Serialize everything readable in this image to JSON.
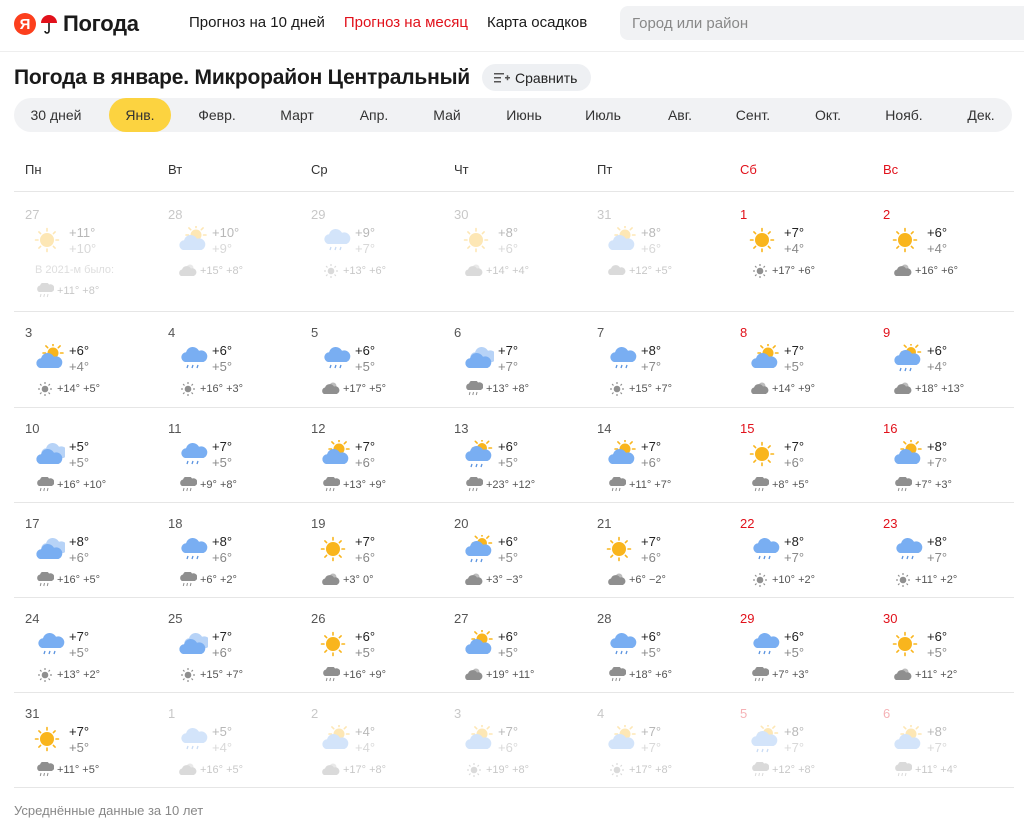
{
  "header": {
    "logo_ya": "Я",
    "logo_text": "Погода",
    "nav": [
      {
        "label": "Прогноз на 10 дней",
        "active": false
      },
      {
        "label": "Прогноз на месяц",
        "active": true
      },
      {
        "label": "Карта осадков",
        "active": false
      }
    ],
    "search_placeholder": "Город или район"
  },
  "title": "Погода в январе. Микрорайон Центральный",
  "compare_label": "Сравнить",
  "months": [
    "30 дней",
    "Янв.",
    "Февр.",
    "Март",
    "Апр.",
    "Май",
    "Июнь",
    "Июль",
    "Авг.",
    "Сент.",
    "Окт.",
    "Нояб.",
    "Дек."
  ],
  "active_month": "Янв.",
  "weekdays": [
    "Пн",
    "Вт",
    "Ср",
    "Чт",
    "Пт",
    "Сб",
    "Вс"
  ],
  "colors": {
    "accent": "#fcd340",
    "weekend": "#e1111b",
    "sun": "#f9b51d",
    "cloud": "#79aef2"
  },
  "weeks": [
    [
      {
        "day": "27",
        "faded": true,
        "icon": "sun",
        "hi": "+11°",
        "lo": "+10°",
        "note": "В 2021-м было:",
        "clim_icon": "rain",
        "clim": "+11° +8°"
      },
      {
        "day": "28",
        "faded": true,
        "icon": "sun-cloud",
        "hi": "+10°",
        "lo": "+9°",
        "clim_icon": "cloudy-sun",
        "clim": "+15° +8°"
      },
      {
        "day": "29",
        "faded": true,
        "icon": "cloud-rain",
        "hi": "+9°",
        "lo": "+7°",
        "clim_icon": "sun",
        "clim": "+13° +6°"
      },
      {
        "day": "30",
        "faded": true,
        "icon": "sun",
        "hi": "+8°",
        "lo": "+6°",
        "clim_icon": "cloudy-sun",
        "clim": "+14° +4°"
      },
      {
        "day": "31",
        "faded": true,
        "icon": "sun-cloud",
        "hi": "+8°",
        "lo": "+6°",
        "clim_icon": "cloud",
        "clim": "+12° +5°"
      },
      {
        "day": "1",
        "faded": false,
        "icon": "sun",
        "hi": "+7°",
        "lo": "+4°",
        "clim_icon": "sun",
        "clim": "+17° +6°"
      },
      {
        "day": "2",
        "faded": false,
        "icon": "sun",
        "hi": "+6°",
        "lo": "+4°",
        "clim_icon": "cloudy-sun",
        "clim": "+16° +6°"
      }
    ],
    [
      {
        "day": "3",
        "faded": false,
        "icon": "sun-cloud",
        "hi": "+6°",
        "lo": "+4°",
        "clim_icon": "sun",
        "clim": "+14° +5°"
      },
      {
        "day": "4",
        "faded": false,
        "icon": "cloud-rain",
        "hi": "+6°",
        "lo": "+5°",
        "clim_icon": "sun",
        "clim": "+16° +3°"
      },
      {
        "day": "5",
        "faded": false,
        "icon": "cloud-rain",
        "hi": "+6°",
        "lo": "+5°",
        "clim_icon": "cloudy-sun",
        "clim": "+17° +5°"
      },
      {
        "day": "6",
        "faded": false,
        "icon": "cloud",
        "hi": "+7°",
        "lo": "+7°",
        "clim_icon": "rain",
        "clim": "+13° +8°"
      },
      {
        "day": "7",
        "faded": false,
        "icon": "cloud-rain",
        "hi": "+8°",
        "lo": "+7°",
        "clim_icon": "sun",
        "clim": "+15° +7°"
      },
      {
        "day": "8",
        "faded": false,
        "icon": "sun-cloud",
        "hi": "+7°",
        "lo": "+5°",
        "clim_icon": "cloudy-sun",
        "clim": "+14° +9°"
      },
      {
        "day": "9",
        "faded": false,
        "icon": "sun-cloud-rain",
        "hi": "+6°",
        "lo": "+4°",
        "clim_icon": "cloudy-sun",
        "clim": "+18° +13°"
      }
    ],
    [
      {
        "day": "10",
        "faded": false,
        "icon": "cloud",
        "hi": "+5°",
        "lo": "+5°",
        "clim_icon": "rain",
        "clim": "+16° +10°"
      },
      {
        "day": "11",
        "faded": false,
        "icon": "cloud-rain",
        "hi": "+7°",
        "lo": "+5°",
        "clim_icon": "rain",
        "clim": "+9° +8°"
      },
      {
        "day": "12",
        "faded": false,
        "icon": "sun-cloud",
        "hi": "+7°",
        "lo": "+6°",
        "clim_icon": "rain",
        "clim": "+13° +9°"
      },
      {
        "day": "13",
        "faded": false,
        "icon": "sun-cloud-rain",
        "hi": "+6°",
        "lo": "+5°",
        "clim_icon": "rain",
        "clim": "+23° +12°"
      },
      {
        "day": "14",
        "faded": false,
        "icon": "sun-cloud",
        "hi": "+7°",
        "lo": "+6°",
        "clim_icon": "rain",
        "clim": "+11° +7°"
      },
      {
        "day": "15",
        "faded": false,
        "icon": "sun",
        "hi": "+7°",
        "lo": "+6°",
        "clim_icon": "rain",
        "clim": "+8° +5°"
      },
      {
        "day": "16",
        "faded": false,
        "icon": "sun-cloud",
        "hi": "+8°",
        "lo": "+7°",
        "clim_icon": "rain",
        "clim": "+7° +3°"
      }
    ],
    [
      {
        "day": "17",
        "faded": false,
        "icon": "cloud",
        "hi": "+8°",
        "lo": "+6°",
        "clim_icon": "rain",
        "clim": "+16° +5°"
      },
      {
        "day": "18",
        "faded": false,
        "icon": "cloud-rain",
        "hi": "+8°",
        "lo": "+6°",
        "clim_icon": "rain",
        "clim": "+6° +2°"
      },
      {
        "day": "19",
        "faded": false,
        "icon": "sun",
        "hi": "+7°",
        "lo": "+6°",
        "clim_icon": "cloudy-sun",
        "clim": "+3° 0°"
      },
      {
        "day": "20",
        "faded": false,
        "icon": "sun-cloud-rain",
        "hi": "+6°",
        "lo": "+5°",
        "clim_icon": "cloudy-sun",
        "clim": "+3° −3°"
      },
      {
        "day": "21",
        "faded": false,
        "icon": "sun",
        "hi": "+7°",
        "lo": "+6°",
        "clim_icon": "cloudy-sun",
        "clim": "+6° −2°"
      },
      {
        "day": "22",
        "faded": false,
        "icon": "cloud-rain",
        "hi": "+8°",
        "lo": "+7°",
        "clim_icon": "sun",
        "clim": "+10° +2°"
      },
      {
        "day": "23",
        "faded": false,
        "icon": "cloud-rain",
        "hi": "+8°",
        "lo": "+7°",
        "clim_icon": "sun",
        "clim": "+11° +2°"
      }
    ],
    [
      {
        "day": "24",
        "faded": false,
        "icon": "cloud-rain",
        "hi": "+7°",
        "lo": "+5°",
        "clim_icon": "sun",
        "clim": "+13° +2°"
      },
      {
        "day": "25",
        "faded": false,
        "icon": "cloud",
        "hi": "+7°",
        "lo": "+6°",
        "clim_icon": "sun",
        "clim": "+15° +7°"
      },
      {
        "day": "26",
        "faded": false,
        "icon": "sun",
        "hi": "+6°",
        "lo": "+5°",
        "clim_icon": "rain",
        "clim": "+16° +9°"
      },
      {
        "day": "27",
        "faded": false,
        "icon": "sun-cloud",
        "hi": "+6°",
        "lo": "+5°",
        "clim_icon": "cloudy-sun",
        "clim": "+19° +11°"
      },
      {
        "day": "28",
        "faded": false,
        "icon": "cloud-rain",
        "hi": "+6°",
        "lo": "+5°",
        "clim_icon": "rain",
        "clim": "+18° +6°"
      },
      {
        "day": "29",
        "faded": false,
        "icon": "cloud-rain",
        "hi": "+6°",
        "lo": "+5°",
        "clim_icon": "rain",
        "clim": "+7° +3°"
      },
      {
        "day": "30",
        "faded": false,
        "icon": "sun",
        "hi": "+6°",
        "lo": "+5°",
        "clim_icon": "cloudy-sun",
        "clim": "+11° +2°"
      }
    ],
    [
      {
        "day": "31",
        "faded": false,
        "icon": "sun",
        "hi": "+7°",
        "lo": "+5°",
        "clim_icon": "rain",
        "clim": "+11° +5°"
      },
      {
        "day": "1",
        "faded": true,
        "icon": "cloud-rain",
        "hi": "+5°",
        "lo": "+4°",
        "clim_icon": "cloudy-sun",
        "clim": "+16° +5°"
      },
      {
        "day": "2",
        "faded": true,
        "icon": "sun-cloud",
        "hi": "+4°",
        "lo": "+4°",
        "clim_icon": "cloudy-sun",
        "clim": "+17° +8°"
      },
      {
        "day": "3",
        "faded": true,
        "icon": "sun-cloud",
        "hi": "+7°",
        "lo": "+6°",
        "clim_icon": "sun",
        "clim": "+19° +8°"
      },
      {
        "day": "4",
        "faded": true,
        "icon": "sun-cloud",
        "hi": "+7°",
        "lo": "+7°",
        "clim_icon": "sun",
        "clim": "+17° +8°"
      },
      {
        "day": "5",
        "faded": true,
        "icon": "sun-cloud-rain",
        "hi": "+8°",
        "lo": "+7°",
        "clim_icon": "rain",
        "clim": "+12° +8°"
      },
      {
        "day": "6",
        "faded": true,
        "icon": "sun-cloud",
        "hi": "+8°",
        "lo": "+7°",
        "clim_icon": "rain",
        "clim": "+11° +4°"
      }
    ]
  ],
  "footer_note": "Усреднённые данные за 10 лет"
}
